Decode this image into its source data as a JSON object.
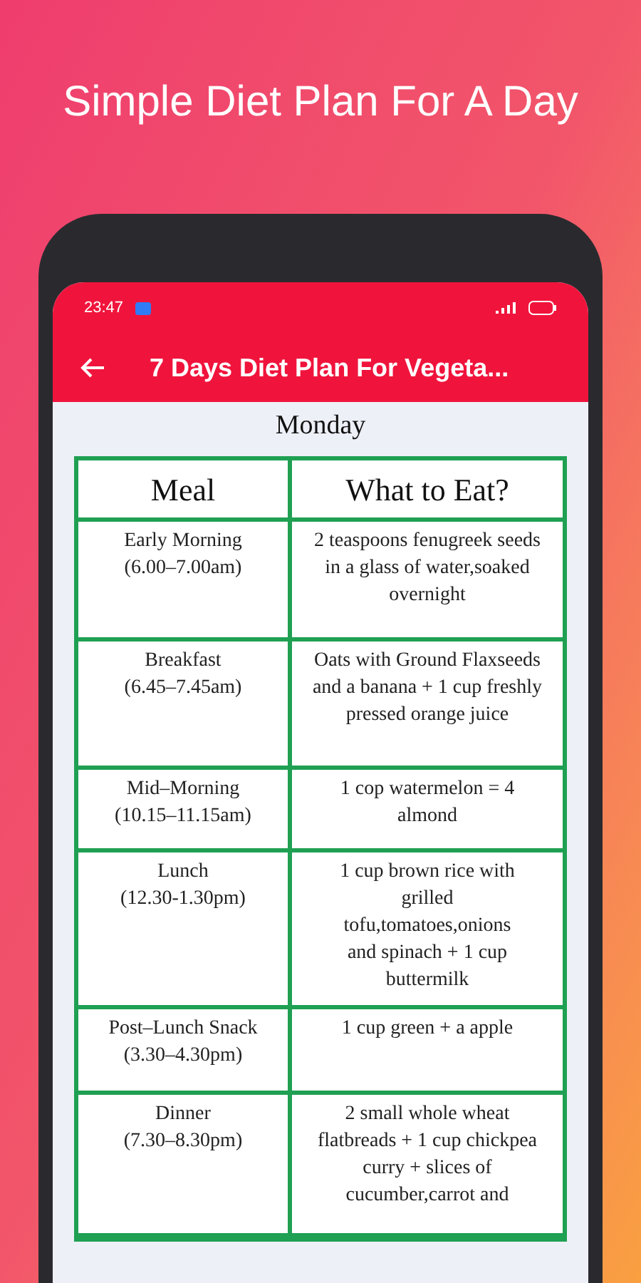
{
  "headline": "Simple Diet Plan For A Day",
  "status_bar": {
    "time": "23:47"
  },
  "app_bar": {
    "title": "7 Days Diet Plan For Vegeta..."
  },
  "day": "Monday",
  "table": {
    "columns": [
      "Meal",
      "What to Eat?"
    ],
    "rows": [
      {
        "meal": "Early Morning\n(6.00–7.00am)",
        "food": "2 teaspoons fenugreek seeds in a glass of water,soaked overnight"
      },
      {
        "meal": "Breakfast\n(6.45–7.45am)",
        "food": "Oats with Ground Flaxseeds and a banana + 1 cup freshly pressed orange juice"
      },
      {
        "meal": "Mid–Morning\n(10.15–11.15am)",
        "food": "1 cop watermelon = 4 almond"
      },
      {
        "meal": "Lunch\n(12.30-1.30pm)",
        "food": "1 cup brown rice with grilled tofu,tomatoes,onions and spinach + 1 cup buttermilk"
      },
      {
        "meal": "Post–Lunch Snack\n(3.30–4.30pm)",
        "food": "1 cup green + a apple"
      },
      {
        "meal": "Dinner\n(7.30–8.30pm)",
        "food": "2 small whole wheat flatbreads + 1 cup chickpea curry + slices of cucumber,carrot and"
      }
    ]
  }
}
